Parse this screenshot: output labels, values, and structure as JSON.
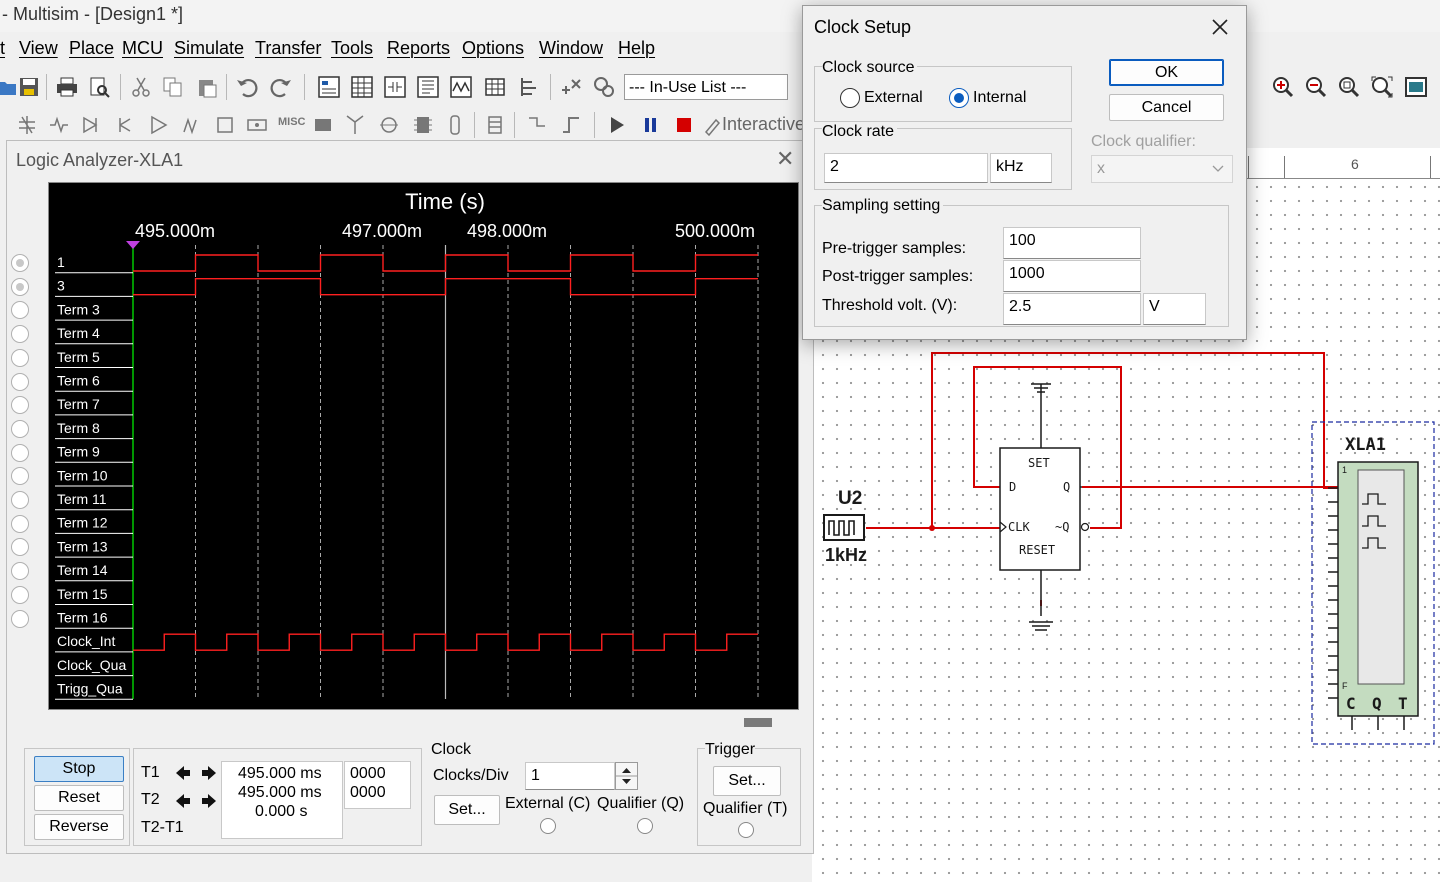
{
  "app": {
    "title": "- Multisim - [Design1 *]",
    "menu": [
      "t",
      "View",
      "Place",
      "MCU",
      "Simulate",
      "Transfer",
      "Tools",
      "Reports",
      "Options",
      "Window",
      "Help"
    ],
    "in_use_list": "--- In-Use List ---",
    "interactive_label": "Interactive",
    "misc_label": "MISC"
  },
  "logic_analyzer": {
    "title": "Logic Analyzer-XLA1",
    "axis_title": "Time (s)",
    "time_labels": [
      "495.000m",
      "497.000m",
      "498.000m",
      "500.000m"
    ],
    "channels": [
      "1",
      "3",
      "Term 3",
      "Term 4",
      "Term 5",
      "Term 6",
      "Term 7",
      "Term 8",
      "Term 9",
      "Term 10",
      "Term 11",
      "Term 12",
      "Term 13",
      "Term 14",
      "Term 15",
      "Term 16",
      "Clock_Int",
      "Clock_Qua",
      "Trigg_Qua"
    ],
    "buttons": {
      "stop": "Stop",
      "reset": "Reset",
      "reverse": "Reverse"
    },
    "cursors": {
      "t1_label": "T1",
      "t2_label": "T2",
      "diff_label": "T2-T1",
      "t1_value": "495.000 ms",
      "t2_value": "495.000 ms",
      "diff_value": "0.000 s",
      "t1_hex": "0000",
      "t2_hex": "0000"
    },
    "clock": {
      "title": "Clock",
      "clocks_per_div_label": "Clocks/Div",
      "clocks_per_div_value": "1",
      "set_label": "Set...",
      "external_label": "External (C)",
      "qualifier_label": "Qualifier (Q)"
    },
    "trigger": {
      "title": "Trigger",
      "set_label": "Set...",
      "qualifier_label": "Qualifier (T)"
    }
  },
  "clock_setup": {
    "title": "Clock Setup",
    "clock_source_label": "Clock source",
    "external_label": "External",
    "internal_label": "Internal",
    "selected_source": "Internal",
    "clock_rate_label": "Clock rate",
    "clock_rate_value": "2",
    "clock_rate_unit": "kHz",
    "clock_qualifier_label": "Clock qualifier:",
    "clock_qualifier_value": "x",
    "sampling_label": "Sampling setting",
    "pre_trigger_label": "Pre-trigger samples:",
    "pre_trigger_value": "100",
    "post_trigger_label": "Post-trigger samples:",
    "post_trigger_value": "1000",
    "threshold_label": "Threshold volt. (V):",
    "threshold_value": "2.5",
    "threshold_unit": "V",
    "ok_label": "OK",
    "cancel_label": "Cancel"
  },
  "schematic": {
    "source_name": "U2",
    "source_freq": "1kHz",
    "analyzer_name": "XLA1",
    "analyzer_pins": [
      "C",
      "Q",
      "T"
    ],
    "analyzer_pin_first": "1",
    "analyzer_pin_last": "F",
    "ff_pins": {
      "set": "SET",
      "d": "D",
      "q": "Q",
      "clk": "CLK",
      "nq": "~Q",
      "reset": "RESET"
    },
    "ruler_mark": "6",
    "wire_color": "#d40000"
  },
  "signals": {
    "trace_color": "#ff2020",
    "ch1_levels": [
      0,
      1,
      0,
      1,
      0,
      1,
      0,
      1,
      0,
      1
    ],
    "ch3_levels": [
      0,
      1,
      1,
      0,
      0,
      1,
      1,
      0,
      0,
      1
    ],
    "clock_levels": [
      0,
      1,
      0,
      1,
      0,
      1,
      0,
      1,
      0,
      1,
      0,
      1,
      0,
      1,
      0,
      1,
      0,
      1,
      0,
      1
    ]
  }
}
